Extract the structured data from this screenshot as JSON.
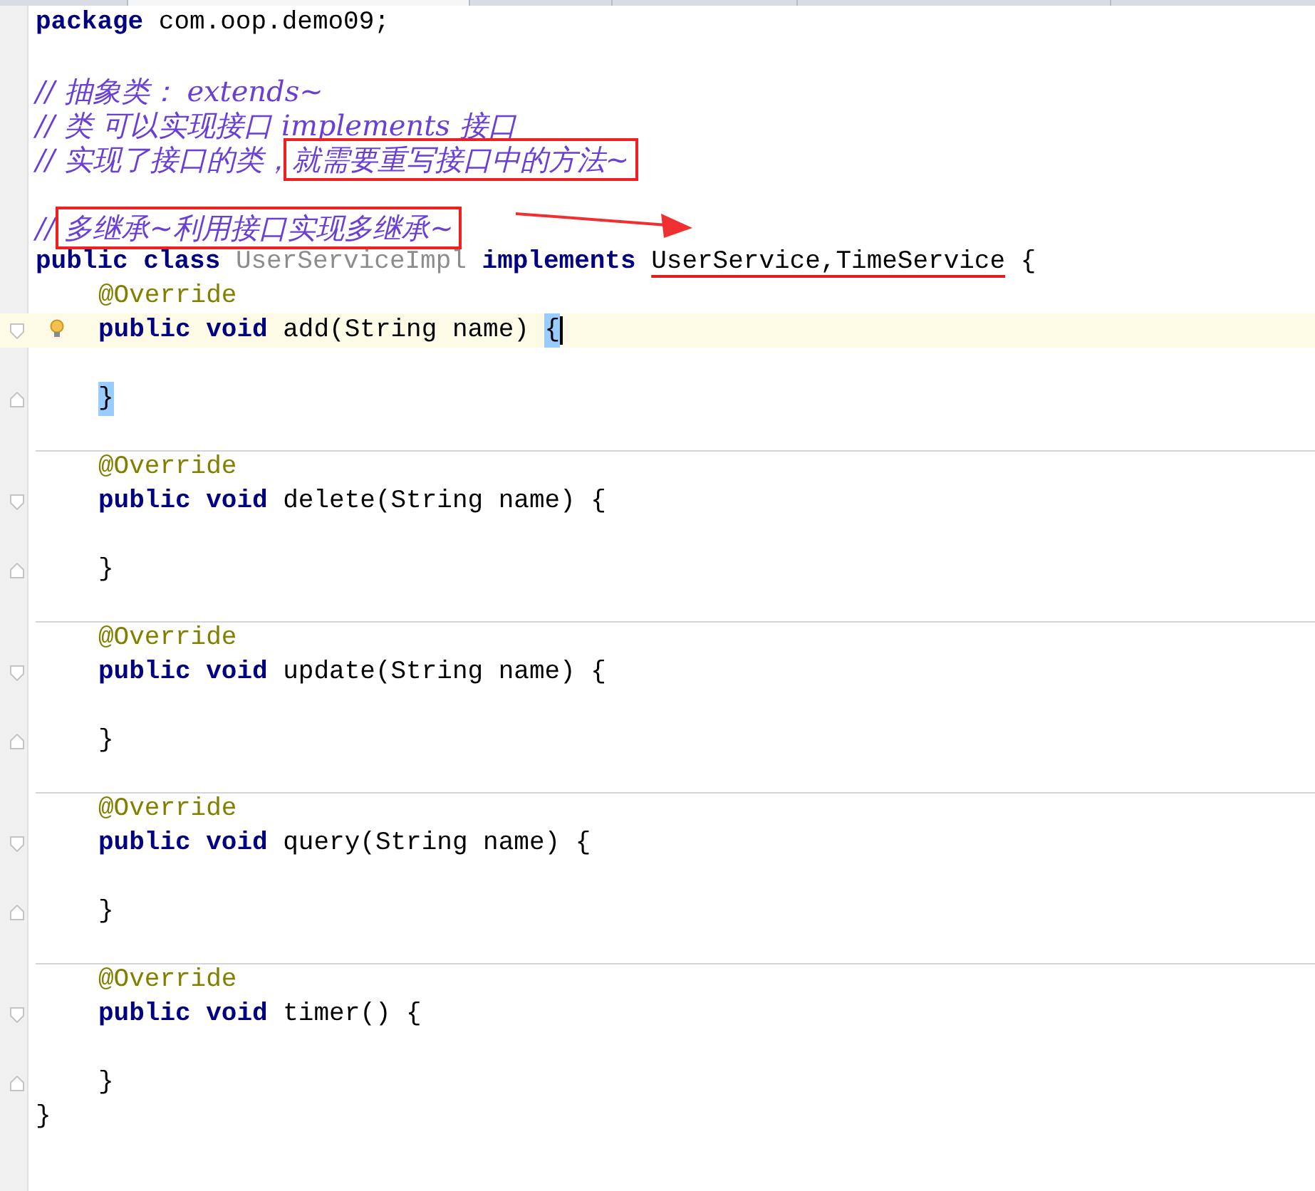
{
  "editor": {
    "package_line": [
      {
        "kind": "keyword",
        "text": "package"
      },
      {
        "kind": "plain",
        "text": " com.oop.demo09;"
      }
    ],
    "comment_lines": [
      [
        {
          "kind": "comment",
          "text": "// 抽象类： extends~"
        }
      ],
      [
        {
          "kind": "comment",
          "text": "// 类 可以实现接口 implements 接口"
        }
      ],
      [
        {
          "kind": "comment",
          "text": "// 实现了接口的类，"
        },
        {
          "kind": "comment",
          "text": "就需要重写接口中的方法~",
          "boxed": true
        }
      ]
    ],
    "note_line": {
      "arrow": true,
      "segments": [
        {
          "kind": "comment",
          "text": "// "
        },
        {
          "kind": "comment",
          "text": "多继承~利用接口实现多继承~",
          "boxed": true
        }
      ]
    },
    "class_line": [
      {
        "kind": "keyword",
        "text": "public class "
      },
      {
        "kind": "unused",
        "text": "UserServiceImpl"
      },
      {
        "kind": "keyword",
        "text": " implements "
      },
      {
        "kind": "plain",
        "text": "UserService,TimeService",
        "underlined": true
      },
      {
        "kind": "plain",
        "text": " {"
      }
    ],
    "methods": [
      {
        "current": true,
        "bulb": true,
        "annotation": "@Override",
        "signature": [
          {
            "kind": "keyword",
            "text": "public void"
          },
          {
            "kind": "plain",
            "text": " add(String name) "
          },
          {
            "kind": "plain",
            "text": "{",
            "matched": true,
            "caret": true
          }
        ],
        "close": [
          {
            "kind": "plain",
            "text": "}",
            "matched": true
          }
        ]
      },
      {
        "current": false,
        "bulb": false,
        "annotation": "@Override",
        "signature": [
          {
            "kind": "keyword",
            "text": "public void"
          },
          {
            "kind": "plain",
            "text": " delete(String name) {"
          }
        ],
        "close": [
          {
            "kind": "plain",
            "text": "}"
          }
        ]
      },
      {
        "current": false,
        "bulb": false,
        "annotation": "@Override",
        "signature": [
          {
            "kind": "keyword",
            "text": "public void"
          },
          {
            "kind": "plain",
            "text": " update(String name) {"
          }
        ],
        "close": [
          {
            "kind": "plain",
            "text": "}"
          }
        ]
      },
      {
        "current": false,
        "bulb": false,
        "annotation": "@Override",
        "signature": [
          {
            "kind": "keyword",
            "text": "public void"
          },
          {
            "kind": "plain",
            "text": " query(String name) {"
          }
        ],
        "close": [
          {
            "kind": "plain",
            "text": "}"
          }
        ]
      },
      {
        "current": false,
        "bulb": false,
        "annotation": "@Override",
        "signature": [
          {
            "kind": "keyword",
            "text": "public void"
          },
          {
            "kind": "plain",
            "text": " timer() {"
          }
        ],
        "close": [
          {
            "kind": "plain",
            "text": "}"
          }
        ]
      }
    ],
    "class_close": "}"
  }
}
